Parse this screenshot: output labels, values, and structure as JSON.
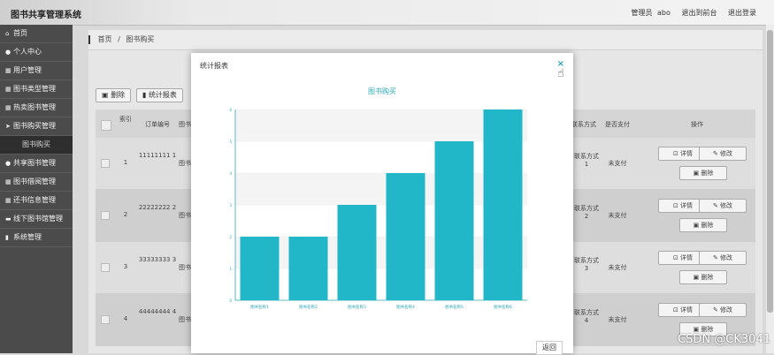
{
  "app": {
    "title": "图书共享管理系统"
  },
  "header": {
    "user_role": "管理员",
    "user_name": "abo",
    "back_link": "退出到前台",
    "logout": "退出登录"
  },
  "sidebar": {
    "items": [
      {
        "icon": "home-icon",
        "glyph": "⌂",
        "label": "首页"
      },
      {
        "icon": "user-icon",
        "glyph": "●",
        "label": "个人中心"
      },
      {
        "icon": "grid-icon",
        "glyph": "▦",
        "label": "用户管理"
      },
      {
        "icon": "grid-icon",
        "glyph": "▦",
        "label": "图书类型管理"
      },
      {
        "icon": "grid-icon",
        "glyph": "▦",
        "label": "热卖图书管理"
      },
      {
        "icon": "send-icon",
        "glyph": "➤",
        "label": "图书购买管理"
      },
      {
        "icon": "",
        "glyph": "",
        "label": "图书购买",
        "sub": true
      },
      {
        "icon": "user-icon",
        "glyph": "●",
        "label": "共享图书管理"
      },
      {
        "icon": "grid-icon",
        "glyph": "▦",
        "label": "图书借阅管理"
      },
      {
        "icon": "grid-icon",
        "glyph": "▦",
        "label": "还书信息管理"
      },
      {
        "icon": "monitor-icon",
        "glyph": "▬",
        "label": "线下图书馆管理"
      },
      {
        "icon": "chart-icon",
        "glyph": "▮",
        "label": "系统管理"
      }
    ]
  },
  "breadcrumb": {
    "home": "首页",
    "sep": "/",
    "current": "图书购买"
  },
  "toolbar": {
    "delete_label": "删除",
    "report_label": "统计报表"
  },
  "table": {
    "headers": {
      "index": "索引",
      "order_no": "订单编号",
      "book": "图书",
      "contact": "联系方式",
      "paid": "是否支付",
      "ops": "操作"
    },
    "rows": [
      {
        "idx": "1",
        "order": "11111111 1",
        "book": "图书",
        "contact": "联系方式 1",
        "paid": "未支付"
      },
      {
        "idx": "2",
        "order": "22222222 2",
        "book": "图书",
        "contact": "联系方式 2",
        "paid": "未支付"
      },
      {
        "idx": "3",
        "order": "33333333 3",
        "book": "图书",
        "contact": "联系方式 3",
        "paid": "未支付"
      },
      {
        "idx": "4",
        "order": "44444444 4",
        "book": "图书",
        "contact": "联系方式 4",
        "paid": "未支付"
      }
    ],
    "detail_label": "详情",
    "edit_label": "修改",
    "remove_label": "删除"
  },
  "modal": {
    "title": "统计报表",
    "close": "×",
    "back_label": "返回"
  },
  "chart_data": {
    "type": "bar",
    "title": "图书购买",
    "categories": [
      "图书名称1",
      "图书名称2",
      "图书名称3",
      "图书名称4",
      "图书名称5",
      "图书名称6"
    ],
    "values": [
      2,
      2,
      3,
      4,
      5,
      6
    ],
    "ylim": [
      0,
      6
    ],
    "yticks": [
      "0",
      "1",
      "2",
      "3",
      "4",
      "5",
      "6"
    ],
    "color": "#22b7c8",
    "grid": true
  },
  "watermark": "CSDN @CK3041"
}
